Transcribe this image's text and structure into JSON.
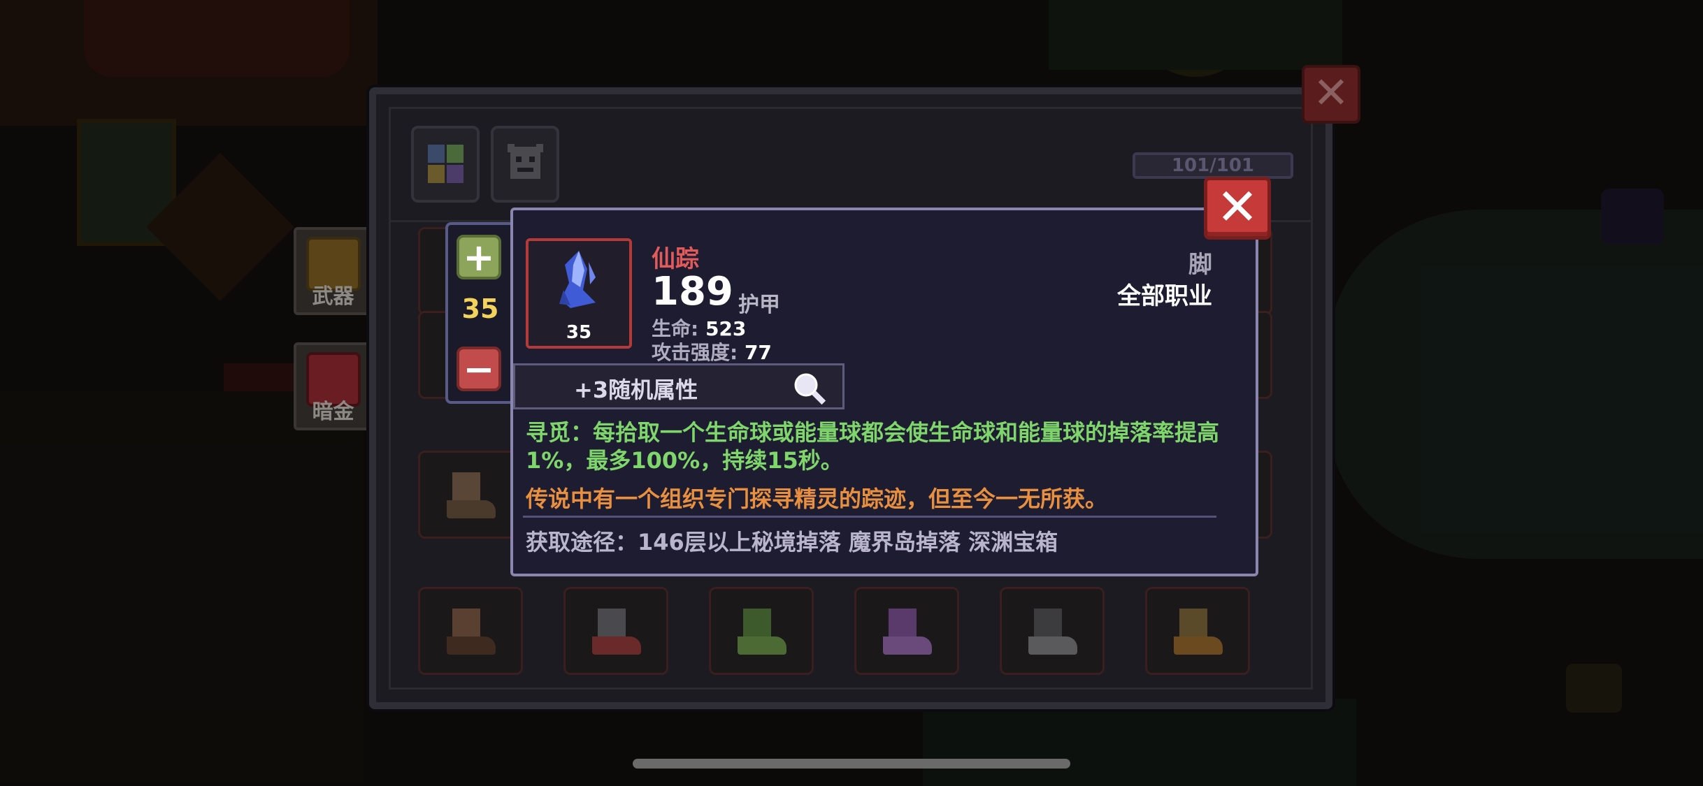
{
  "side_tabs": [
    {
      "label": "武器",
      "icon": "weapon-chest-icon"
    },
    {
      "label": "暗金",
      "icon": "dark-gold-chest-icon"
    }
  ],
  "inventory": {
    "capacity": "101/101",
    "tabs": [
      {
        "icon": "all-categories-icon"
      },
      {
        "icon": "monster-helmet-icon"
      }
    ]
  },
  "level_control": {
    "value": "35"
  },
  "tooltip": {
    "name": "仙踪",
    "score": "189",
    "type": "护甲",
    "item_level": "35",
    "stats": [
      {
        "label": "生命:",
        "value": "523"
      },
      {
        "label": "攻击强度:",
        "value": "77"
      }
    ],
    "slot": "脚",
    "class": "全部职业",
    "random_attr": "+3随机属性",
    "effect_text": "寻觅：每拾取一个生命球或能量球都会使生命球和能量球的掉落率提高1%，最多100%，持续15秒。",
    "lore_text": "传说中有一个组织专门探寻精灵的踪迹，但至今一无所获。",
    "source_text": "获取途径：146层以上秘境掉落 魔界岛掉落 深渊宝箱"
  },
  "colors": {
    "item_name": "#e35a5a",
    "effect": "#7fd66b",
    "lore": "#e8903f",
    "close": "#c63a3a"
  }
}
